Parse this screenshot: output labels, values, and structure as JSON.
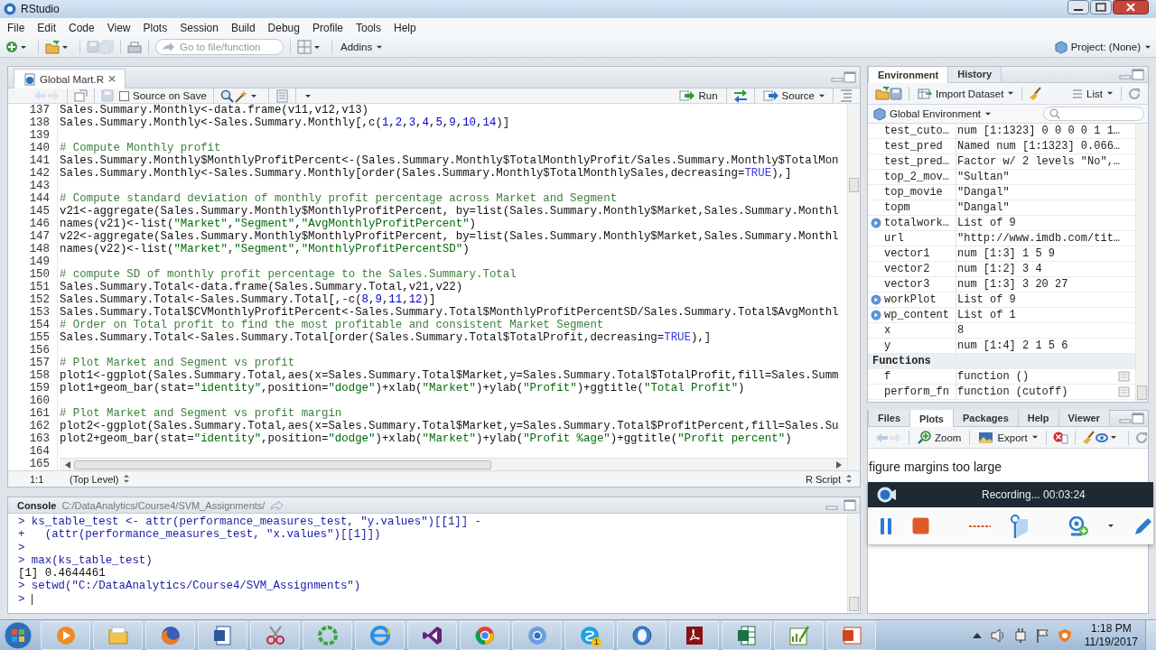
{
  "window": {
    "title": "RStudio"
  },
  "menu": [
    "File",
    "Edit",
    "Code",
    "View",
    "Plots",
    "Session",
    "Build",
    "Debug",
    "Profile",
    "Tools",
    "Help"
  ],
  "toolbar": {
    "goto_placeholder": "Go to file/function",
    "addins": "Addins",
    "project": "Project: (None)"
  },
  "editor": {
    "tabs": [
      {
        "label": "Global Mart.R",
        "selected": true
      }
    ],
    "source_on_save": {
      "label": "Source on Save",
      "checked": false
    },
    "run": "Run",
    "source": "Source",
    "lines": [
      {
        "number": "137",
        "text": "Sales.Summary.Monthly<-data.frame(v11,v12,v13)"
      },
      {
        "number": "138",
        "text": "Sales.Summary.Monthly<-Sales.Summary.Monthly[,c(1,2,3,4,5,9,10,14)]"
      },
      {
        "number": "139"
      },
      {
        "number": "140",
        "text": "# Compute Monthly profit"
      },
      {
        "number": "141",
        "text": "Sales.Summary.Monthly$MonthlyProfitPercent<-(Sales.Summary.Monthly$TotalMonthlyProfit/Sales.Summary.Monthly$TotalMon"
      },
      {
        "number": "142",
        "text": "Sales.Summary.Monthly<-Sales.Summary.Monthly[order(Sales.Summary.Monthly$TotalMonthlySales,decreasing=TRUE),]"
      },
      {
        "number": "143"
      },
      {
        "number": "144",
        "text": "# Compute standard deviation of monthly profit percentage across Market and Segment"
      },
      {
        "number": "145",
        "text": "v21<-aggregate(Sales.Summary.Monthly$MonthlyProfitPercent, by=list(Sales.Summary.Monthly$Market,Sales.Summary.Monthl"
      },
      {
        "number": "146",
        "text": "names(v21)<-list(\"Market\",\"Segment\",\"AvgMonthlyProfitPercent\")"
      },
      {
        "number": "147",
        "text": "v22<-aggregate(Sales.Summary.Monthly$MonthlyProfitPercent, by=list(Sales.Summary.Monthly$Market,Sales.Summary.Monthl"
      },
      {
        "number": "148",
        "text": "names(v22)<-list(\"Market\",\"Segment\",\"MonthlyProfitPercentSD\")"
      },
      {
        "number": "149"
      },
      {
        "number": "150",
        "text": "# compute SD of monthly profit percentage to the Sales.Summary.Total"
      },
      {
        "number": "151",
        "text": "Sales.Summary.Total<-data.frame(Sales.Summary.Total,v21,v22)"
      },
      {
        "number": "152",
        "text": "Sales.Summary.Total<-Sales.Summary.Total[,-c(8,9,11,12)]"
      },
      {
        "number": "153",
        "text": "Sales.Summary.Total$CVMonthlyProfitPercent<-Sales.Summary.Total$MonthlyProfitPercentSD/Sales.Summary.Total$AvgMonthl"
      },
      {
        "number": "154",
        "text": "# Order on Total profit to find the most profitable and consistent Market Segment"
      },
      {
        "number": "155",
        "text": "Sales.Summary.Total<-Sales.Summary.Total[order(Sales.Summary.Total$TotalProfit,decreasing=TRUE),]"
      },
      {
        "number": "156"
      },
      {
        "number": "157",
        "text": "# Plot Market and Segment vs profit"
      },
      {
        "number": "158",
        "text": "plot1<-ggplot(Sales.Summary.Total,aes(x=Sales.Summary.Total$Market,y=Sales.Summary.Total$TotalProfit,fill=Sales.Summ"
      },
      {
        "number": "159",
        "text": "plot1+geom_bar(stat=\"identity\",position=\"dodge\")+xlab(\"Market\")+ylab(\"Profit\")+ggtitle(\"Total Profit\")"
      },
      {
        "number": "160"
      },
      {
        "number": "161",
        "text": "# Plot Market and Segment vs profit margin"
      },
      {
        "number": "162",
        "text": "plot2<-ggplot(Sales.Summary.Total,aes(x=Sales.Summary.Total$Market,y=Sales.Summary.Total$ProfitPercent,fill=Sales.Su"
      },
      {
        "number": "163",
        "text": "plot2+geom_bar(stat=\"identity\",position=\"dodge\")+xlab(\"Market\")+ylab(\"Profit %age\")+ggtitle(\"Profit percent\")"
      },
      {
        "number": "164"
      },
      {
        "number": "165"
      }
    ],
    "status": {
      "position": "1:1",
      "scope": "(Top Level)",
      "file_type": "R Script"
    }
  },
  "console": {
    "title": "Console",
    "path": "C:/DataAnalytics/Course4/SVM_Assignments/",
    "lines": [
      {
        "kind": "input",
        "text": "> ks_table_test <- attr(performance_measures_test, \"y.values\")[[1]] -"
      },
      {
        "kind": "input",
        "text": "+   (attr(performance_measures_test, \"x.values\")[[1]])"
      },
      {
        "kind": "input",
        "text": ">"
      },
      {
        "kind": "input",
        "text": "> max(ks_table_test)"
      },
      {
        "kind": "output",
        "text": "[1] 0.4644461"
      },
      {
        "kind": "input",
        "text": "> setwd(\"C:/DataAnalytics/Course4/SVM_Assignments\")"
      },
      {
        "kind": "prompt",
        "text": ">"
      }
    ]
  },
  "environment": {
    "tabs": [
      {
        "label": "Environment",
        "selected": true
      },
      {
        "label": "History",
        "selected": false
      }
    ],
    "import": "Import Dataset",
    "view": "List",
    "scope": "Global Environment",
    "rows": [
      {
        "kind": "variable",
        "name": "test_cuto…",
        "value": "num [1:1323] 0 0 0 0 1 1…",
        "expandable": false
      },
      {
        "kind": "variable",
        "name": "test_pred",
        "value": "Named num [1:1323] 0.066…",
        "expandable": false
      },
      {
        "kind": "variable",
        "name": "test_pred…",
        "value": "Factor w/ 2 levels \"No\",…",
        "expandable": false
      },
      {
        "kind": "variable",
        "name": "top_2_mov…",
        "value": "\"Sultan\"",
        "expandable": false
      },
      {
        "kind": "variable",
        "name": "top_movie",
        "value": "\"Dangal\"",
        "expandable": false
      },
      {
        "kind": "variable",
        "name": "topm",
        "value": "\"Dangal\"",
        "expandable": false
      },
      {
        "kind": "variable",
        "name": "totalwork…",
        "value": "List of 9",
        "expandable": true
      },
      {
        "kind": "variable",
        "name": "url",
        "value": "\"http://www.imdb.com/tit…",
        "expandable": false
      },
      {
        "kind": "variable",
        "name": "vector1",
        "value": "num [1:3] 1 5 9",
        "expandable": false
      },
      {
        "kind": "variable",
        "name": "vector2",
        "value": "num [1:2] 3 4",
        "expandable": false
      },
      {
        "kind": "variable",
        "name": "vector3",
        "value": "num [1:3] 3 20 27",
        "expandable": false
      },
      {
        "kind": "variable",
        "name": "workPlot",
        "value": "List of 9",
        "expandable": true
      },
      {
        "kind": "variable",
        "name": "wp_content",
        "value": "List of 1",
        "expandable": true
      },
      {
        "kind": "variable",
        "name": "x",
        "value": "8",
        "expandable": false
      },
      {
        "kind": "variable",
        "name": "y",
        "value": "num [1:4] 2 1 5 6",
        "expandable": false
      },
      {
        "kind": "section",
        "name": "Functions"
      },
      {
        "kind": "function",
        "name": "f",
        "value": "function ()"
      },
      {
        "kind": "function",
        "name": "perform_fn",
        "value": "function (cutoff)"
      }
    ]
  },
  "plots": {
    "tabs": [
      {
        "label": "Files",
        "selected": false
      },
      {
        "label": "Plots",
        "selected": true
      },
      {
        "label": "Packages",
        "selected": false
      },
      {
        "label": "Help",
        "selected": false
      },
      {
        "label": "Viewer",
        "selected": false
      }
    ],
    "zoom": "Zoom",
    "export": "Export",
    "message": "figure margins too large"
  },
  "recorder": {
    "status": "Recording... 00:03:24"
  },
  "taskbar": {
    "badge": "1",
    "time": "1:18 PM",
    "date": "11/19/2017"
  }
}
